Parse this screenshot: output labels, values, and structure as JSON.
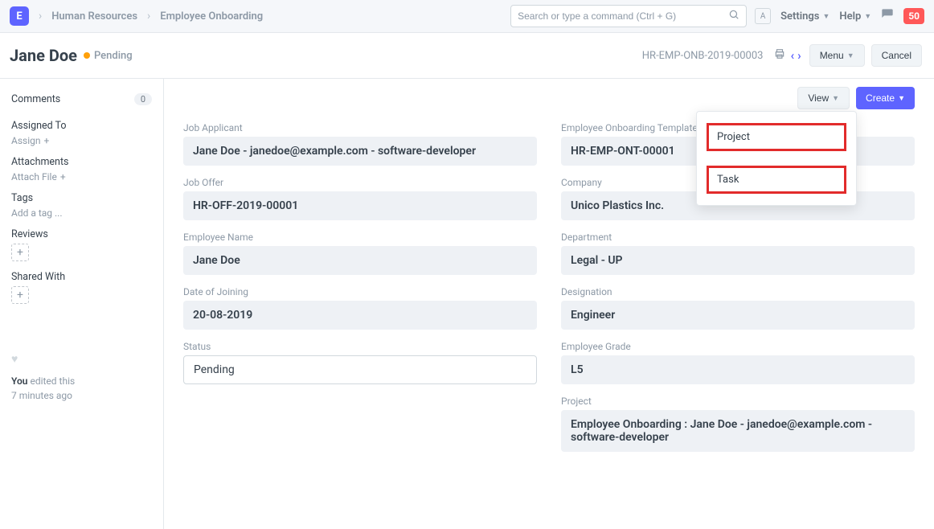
{
  "navbar": {
    "logo_letter": "E",
    "breadcrumbs": [
      "Human Resources",
      "Employee Onboarding"
    ],
    "search_placeholder": "Search or type a command (Ctrl + G)",
    "user_letter": "A",
    "settings_label": "Settings",
    "help_label": "Help",
    "notification_count": "50"
  },
  "page_head": {
    "title": "Jane Doe",
    "status_label": "Pending",
    "doc_id": "HR-EMP-ONB-2019-00003",
    "menu_label": "Menu",
    "cancel_label": "Cancel"
  },
  "sidebar": {
    "comments_label": "Comments",
    "comments_count": "0",
    "assigned_to_label": "Assigned To",
    "assign_action": "Assign",
    "attachments_label": "Attachments",
    "attach_action": "Attach File",
    "tags_label": "Tags",
    "tags_action": "Add a tag ...",
    "reviews_label": "Reviews",
    "shared_label": "Shared With",
    "edit_you": "You",
    "edit_rest": " edited this",
    "edit_time": "7 minutes ago"
  },
  "toolbar": {
    "view_label": "View",
    "create_label": "Create"
  },
  "dropdown": {
    "item1": "Project",
    "item2": "Task"
  },
  "form": {
    "left": {
      "job_applicant_label": "Job Applicant",
      "job_applicant_value": "Jane Doe - janedoe@example.com - software-developer",
      "job_offer_label": "Job Offer",
      "job_offer_value": "HR-OFF-2019-00001",
      "employee_name_label": "Employee Name",
      "employee_name_value": "Jane Doe",
      "doj_label": "Date of Joining",
      "doj_value": "20-08-2019",
      "status_label": "Status",
      "status_value": "Pending"
    },
    "right": {
      "template_label": "Employee Onboarding Template",
      "template_value": "HR-EMP-ONT-00001",
      "company_label": "Company",
      "company_value": "Unico Plastics Inc.",
      "department_label": "Department",
      "department_value": "Legal - UP",
      "designation_label": "Designation",
      "designation_value": "Engineer",
      "grade_label": "Employee Grade",
      "grade_value": "L5",
      "project_label": "Project",
      "project_value": "Employee Onboarding : Jane Doe - janedoe@example.com - software-developer"
    }
  }
}
